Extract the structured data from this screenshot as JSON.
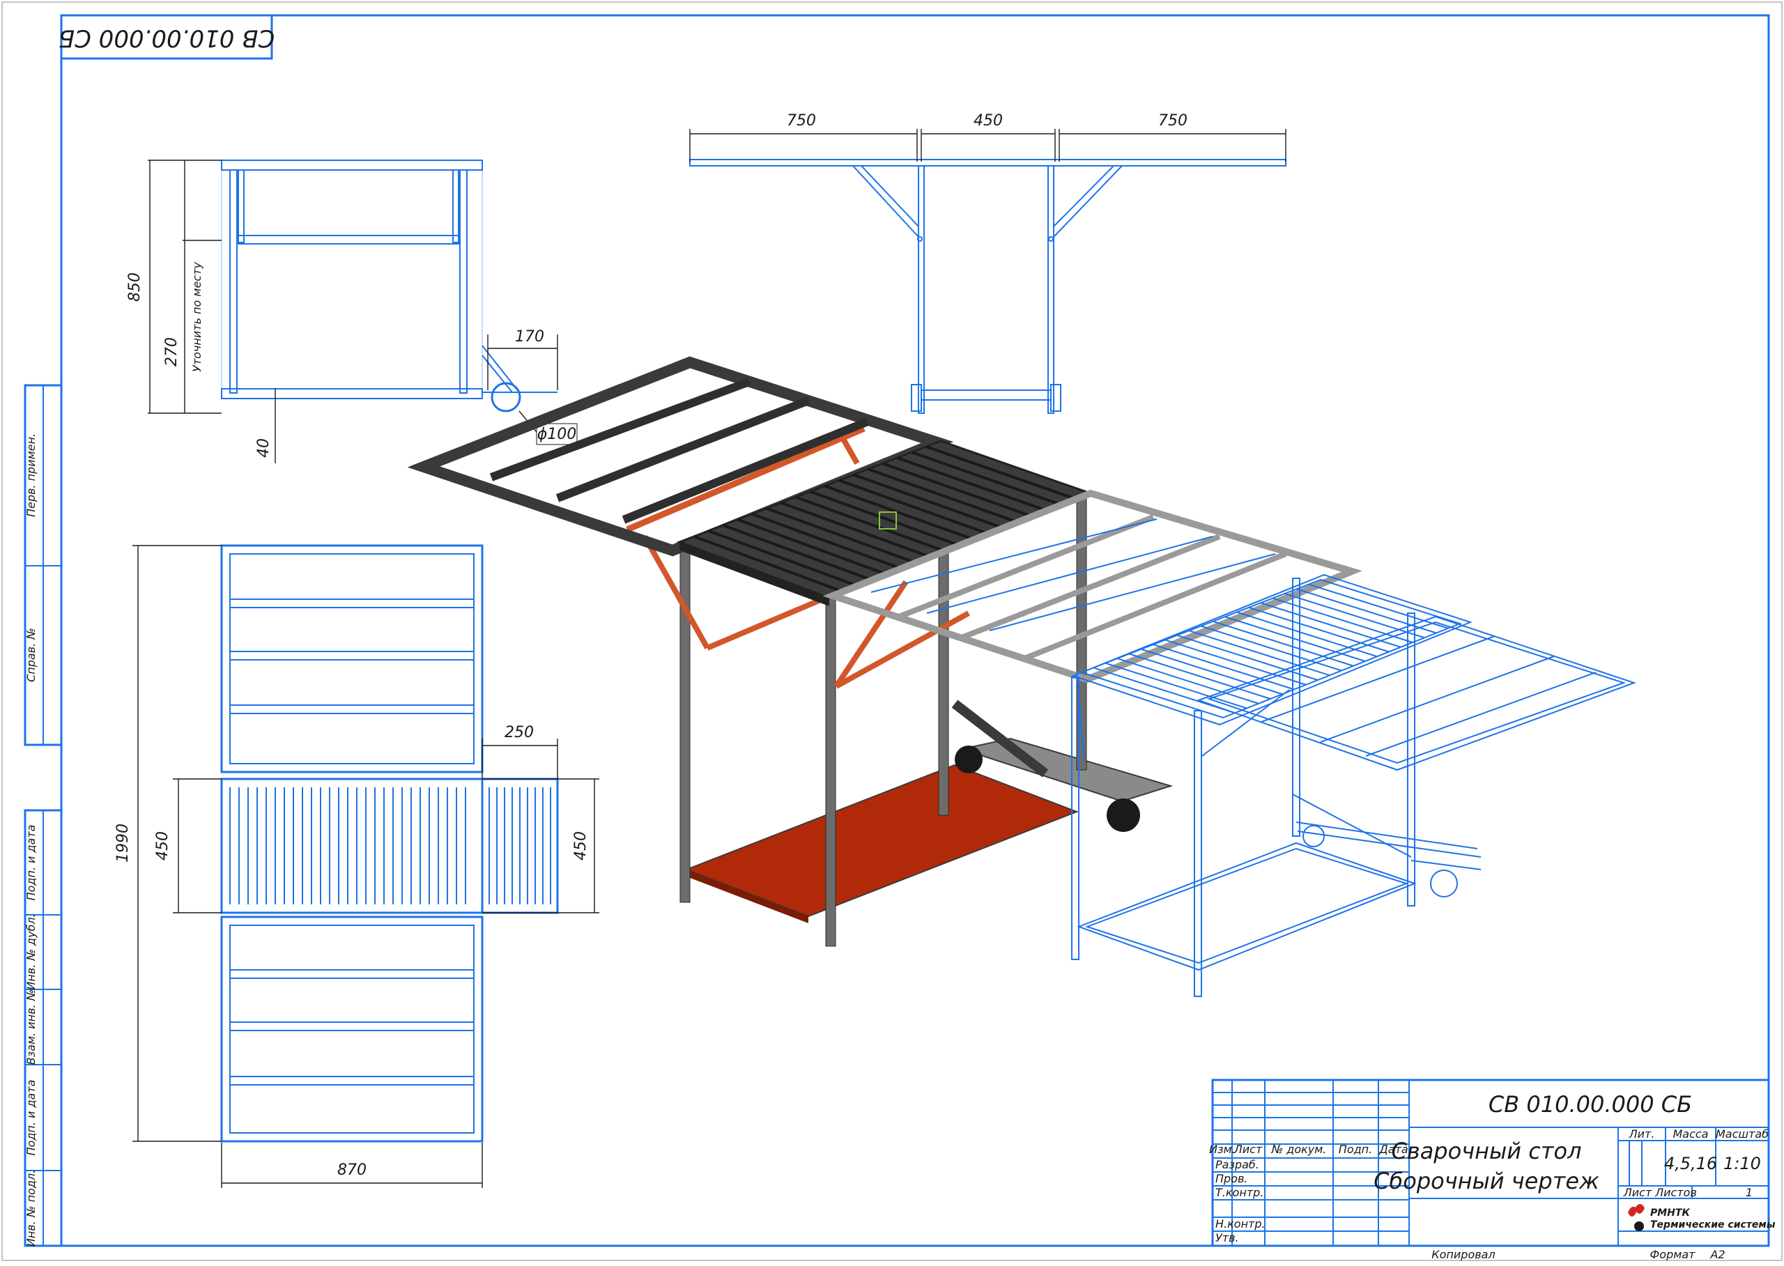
{
  "doc_code": "СВ 010.00.000 СБ",
  "doc_code_top": "СВ 010.00.000 СБ",
  "title": {
    "line1": "Сварочный стол",
    "line2": "Сборочный чертеж"
  },
  "dims": {
    "d850": "850",
    "d270": "270",
    "d40": "40",
    "d170": "170",
    "d100": "ϕ100",
    "note": "Уточнить по месту",
    "d750a": "750",
    "d450a": "450",
    "d750b": "750",
    "d1990": "1990",
    "d450l": "450",
    "d450r": "450",
    "d250": "250",
    "d870": "870"
  },
  "table_headers": {
    "izm": "Изм.",
    "list": "Лист",
    "docnum": "№ докум.",
    "podp": "Подп.",
    "data": "Дата"
  },
  "roles": [
    "Разраб.",
    "Пров.",
    "Т.контр.",
    "",
    "Н.контр.",
    "Утв."
  ],
  "lit": "Лит.",
  "massa_label": "Масса",
  "scale_label": "Масштаб",
  "massa": "4,5,16",
  "scale": "1:10",
  "sheet_label": "Лист",
  "sheets_label": "Листов",
  "sheets": "1",
  "company": {
    "line1": "РМНТК",
    "line2": "Термические системы"
  },
  "copied": "Копировал",
  "format_label": "Формат",
  "format": "А2",
  "side_stamps": [
    "Перв. примен.",
    "Справ. №",
    "Подп. и дата",
    "Инв. № дубл.",
    "Взам. инв. №",
    "Подп. и дата",
    "Инв. № подл."
  ],
  "colors": {
    "frame": "#1e73e8",
    "dark_steel": "#3a3a3a",
    "orange": "#d2572a",
    "red_plate": "#b02a0a"
  }
}
